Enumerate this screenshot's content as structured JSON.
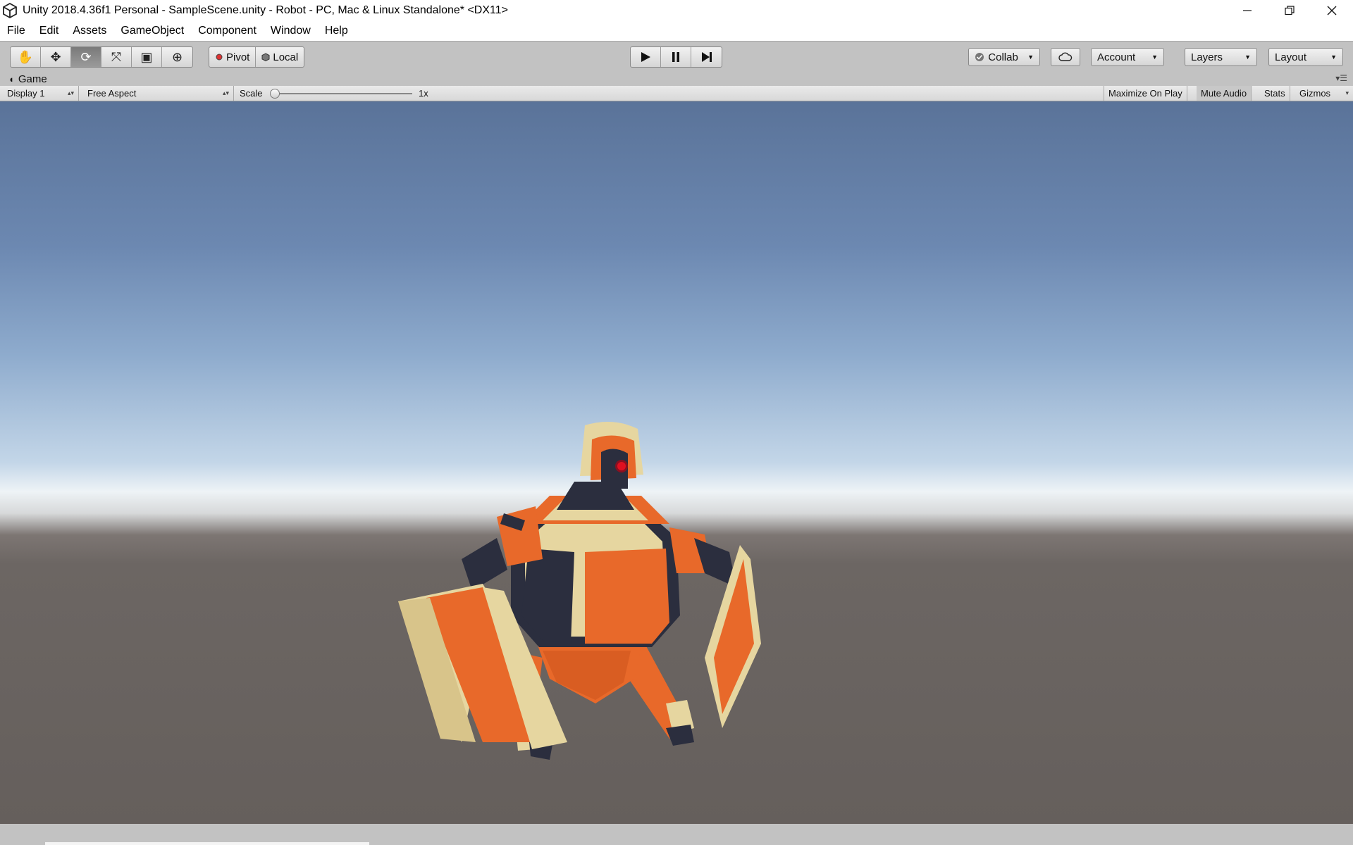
{
  "window": {
    "title": "Unity 2018.4.36f1 Personal - SampleScene.unity - Robot - PC, Mac & Linux Standalone* <DX11>",
    "controls": {
      "minimize": "—",
      "restore": "❐",
      "close": "✕"
    }
  },
  "menu": {
    "items": [
      "File",
      "Edit",
      "Assets",
      "GameObject",
      "Component",
      "Window",
      "Help"
    ]
  },
  "toolbar": {
    "tools": [
      {
        "icon": "hand-tool-icon",
        "glyph": "✋"
      },
      {
        "icon": "move-tool-icon",
        "glyph": "✥"
      },
      {
        "icon": "rotate-tool-icon",
        "glyph": "⟳"
      },
      {
        "icon": "scale-tool-icon",
        "glyph": "⤧"
      },
      {
        "icon": "rect-tool-icon",
        "glyph": "▣"
      },
      {
        "icon": "transform-tool-icon",
        "glyph": "⊕"
      }
    ],
    "active_tool": "rotate-tool-icon",
    "pivot_label": "Pivot",
    "local_label": "Local",
    "collab_label": "Collab",
    "account_label": "Account",
    "layers_label": "Layers",
    "layout_label": "Layout"
  },
  "game_tab": {
    "label": "Game"
  },
  "game_toolbar": {
    "display": "Display 1",
    "aspect": "Free Aspect",
    "scale_label": "Scale",
    "scale_value": "1x",
    "maximize": "Maximize On Play",
    "mute": "Mute Audio",
    "stats": "Stats",
    "gizmos": "Gizmos"
  },
  "colors": {
    "robot_orange": "#e8692a",
    "robot_cream": "#e6d6a0",
    "robot_dark": "#2b2e3e",
    "robot_eye": "#e01020"
  }
}
